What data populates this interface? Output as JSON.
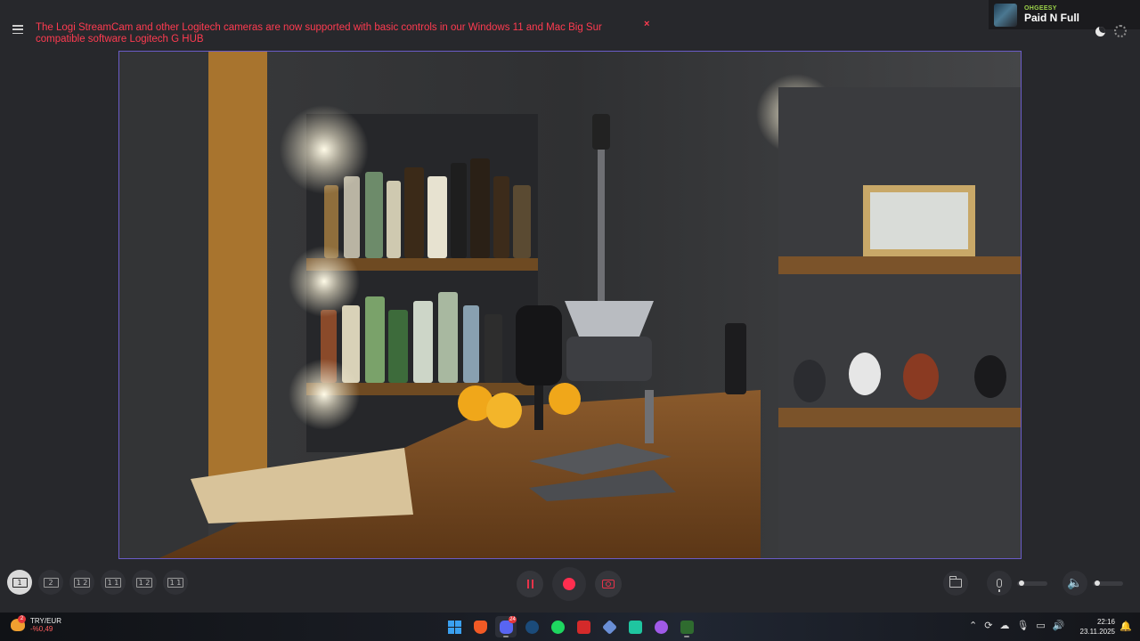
{
  "banner": {
    "message": "The Logi StreamCam and other Logitech cameras are now supported with basic controls in our Windows 11 and Mac Big Sur compatible software Logitech G HUB",
    "close_icon": "×"
  },
  "now_playing": {
    "artist": "OHGEESY",
    "title": "Paid N Full"
  },
  "layouts": [
    {
      "label": "1",
      "selected": true
    },
    {
      "label": "2"
    },
    {
      "label": "1 2"
    },
    {
      "label": "1 1"
    },
    {
      "label": "1 2"
    },
    {
      "label": "1 1"
    }
  ],
  "controls": {
    "pause_icon": "pause-icon",
    "record_icon": "record-icon",
    "snapshot_icon": "camera-icon"
  },
  "audio": {
    "mic_level": 0.08,
    "speaker_level": 0.08
  },
  "taskbar": {
    "widget": {
      "badge": "2",
      "name": "TRY/EUR",
      "value": "-%0,49"
    },
    "discord_badge": "24",
    "clock": {
      "time": "22:16",
      "date": "23.11.2025"
    }
  },
  "colors": {
    "accent_red": "#ff2e4f",
    "preview_border": "#6a5cc7",
    "background": "#27282c"
  }
}
